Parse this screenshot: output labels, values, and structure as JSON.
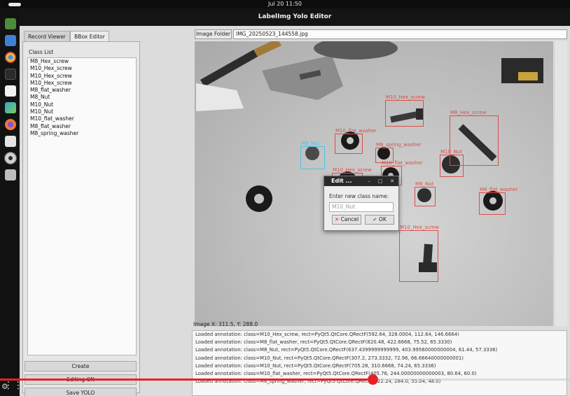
{
  "topbar": {
    "clock": "Jul 20  11:50"
  },
  "dock": {
    "icons": [
      "files-icon",
      "store-icon",
      "chrome-icon",
      "terminal-icon",
      "editor-icon",
      "image-viewer-icon",
      "firefox-icon",
      "labelimg-icon",
      "disc-icon",
      "drive-icon"
    ]
  },
  "window": {
    "title": "LabelImg Yolo Editor"
  },
  "tabs": [
    {
      "label": "Record Viewer"
    },
    {
      "label": "BBox Editor"
    }
  ],
  "class_list": {
    "label": "Class List",
    "items": [
      "M8_Hex_screw",
      "M10_Hex_screw",
      "M10_Hex_screw",
      "M10_Hex_screw",
      "M8_flat_washer",
      "M8_Nut",
      "M10_Nut",
      "M10_Nut",
      "M10_flat_washer",
      "M8_flat_washer",
      "M8_spring_washer"
    ]
  },
  "buttons": {
    "create": "Create",
    "editing": "Editing ON",
    "save": "Save YOLO"
  },
  "image_folder_button": "Image Folder",
  "filename": "IMG_20250523_144558.jpg",
  "coords": "Image X: 311.5, Y: 288.0",
  "bboxes": [
    {
      "label": "M10_Hex_screw",
      "color": "#d8504a"
    },
    {
      "label": "M8_Hex_screw",
      "color": "#d8504a"
    },
    {
      "label": "M10_flat_washer",
      "color": "#d8504a"
    },
    {
      "label": "M8_spring_washer",
      "color": "#d8504a"
    },
    {
      "label": "M8_Nut",
      "color": "#4fc3e6"
    },
    {
      "label": "M10_Hex_screw",
      "color": "#d8504a"
    },
    {
      "label": "M10_flat_washer",
      "color": "#d8504a"
    },
    {
      "label": "M10_Nut",
      "color": "#d8504a"
    },
    {
      "label": "M8_Nut",
      "color": "#d8504a"
    },
    {
      "label": "M8_flat_washer",
      "color": "#d8504a"
    },
    {
      "label": "M10_Hex_screw",
      "color": "#d8504a"
    }
  ],
  "dialog": {
    "title": "Edit ...",
    "prompt": "Enter new class name:",
    "input_value": "M10_Nut",
    "cancel": "Cancel",
    "ok": "OK"
  },
  "log_lines": [
    "Loaded annotation: class=M10_Hex_screw, rect=PyQt5.QtCore.QRectF(592.64, 328.0004, 112.64, 146.6664)",
    "Loaded annotation: class=M8_flat_washer, rect=PyQt5.QtCore.QRectF(820.48, 422.6668, 75.52, 65.3330)",
    "Loaded annotation: class=M8_Nut, rect=PyQt5.QtCore.QRectF(637.4399999999999, 403.99560000000004, 61.44, 57.3336)",
    "Loaded annotation: class=M10_Nut, rect=PyQt5.QtCore.QRectF(307.2, 273.3332, 72.96, 66.66640000000001)",
    "Loaded annotation: class=M10_Nut, rect=PyQt5.QtCore.QRectF(705.28, 310.6668, 74.24, 65.3336)",
    "Loaded annotation: class=M10_flat_washer, rect=PyQt5.QtCore.QRectF(405.76, 244.00000000000003, 80.64, 60.0)",
    "Loaded annotation: class=M8_spring_washer, rect=PyQt5.QtCore.QRectF(522.24, 284.0, 55.04, 48.0)"
  ],
  "video_progress": 0.653
}
